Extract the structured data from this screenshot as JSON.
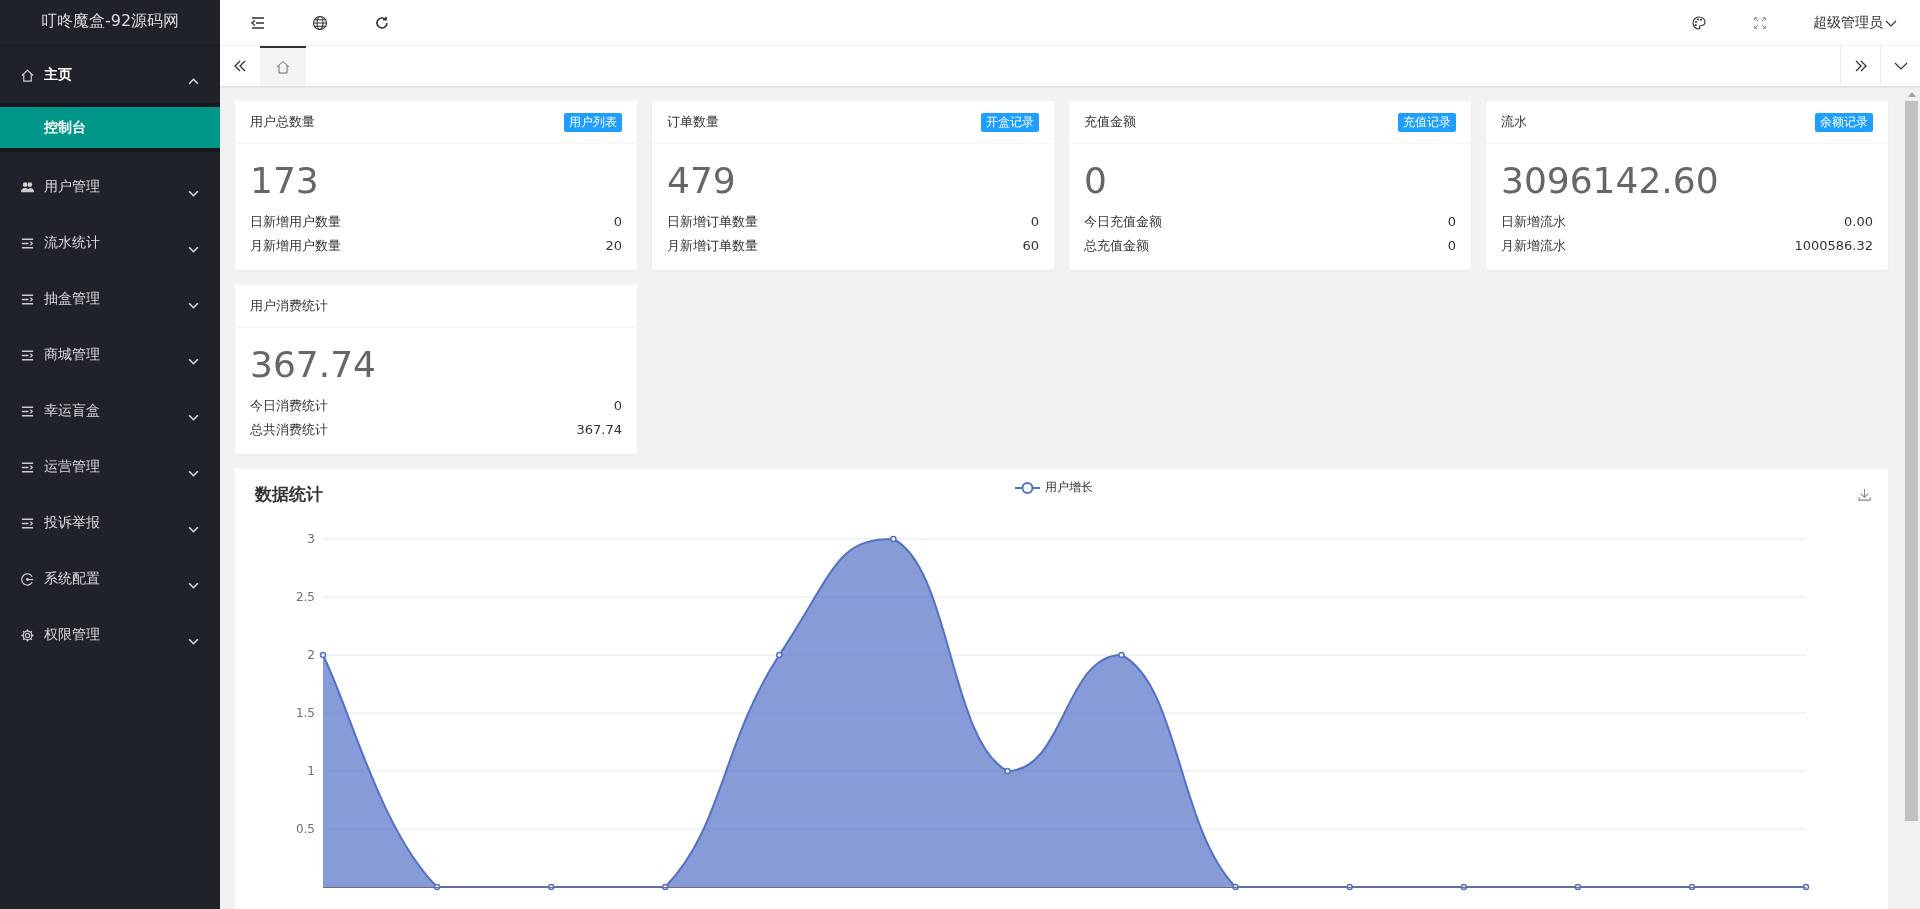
{
  "sidebar": {
    "logo": "叮咚魔盒-92源码网",
    "items": [
      {
        "label": "主页",
        "kind": "home",
        "expanded": true,
        "children": [
          {
            "label": "控制台",
            "selected": true
          }
        ]
      },
      {
        "label": "用户管理",
        "kind": "users",
        "expanded": false
      },
      {
        "label": "流水统计",
        "kind": "list",
        "expanded": false
      },
      {
        "label": "抽盒管理",
        "kind": "list",
        "expanded": false
      },
      {
        "label": "商城管理",
        "kind": "list",
        "expanded": false
      },
      {
        "label": "幸运盲盒",
        "kind": "list",
        "expanded": false
      },
      {
        "label": "运营管理",
        "kind": "list",
        "expanded": false
      },
      {
        "label": "投诉举报",
        "kind": "list",
        "expanded": false
      },
      {
        "label": "系统配置",
        "kind": "gauge",
        "expanded": false
      },
      {
        "label": "权限管理",
        "kind": "gear",
        "expanded": false
      }
    ]
  },
  "header": {
    "user": "超级管理员"
  },
  "tabs": [
    {
      "kind": "home",
      "selected": true
    }
  ],
  "cards": [
    {
      "title": "用户总数量",
      "badge": "用户列表",
      "value": "173",
      "rows": [
        {
          "label": "日新增用户数量",
          "value": "0"
        },
        {
          "label": "月新增用户数量",
          "value": "20"
        }
      ]
    },
    {
      "title": "订单数量",
      "badge": "开盒记录",
      "value": "479",
      "rows": [
        {
          "label": "日新增订单数量",
          "value": "0"
        },
        {
          "label": "月新增订单数量",
          "value": "60"
        }
      ]
    },
    {
      "title": "充值金额",
      "badge": "充值记录",
      "value": "0",
      "rows": [
        {
          "label": "今日充值金额",
          "value": "0"
        },
        {
          "label": "总充值金额",
          "value": "0"
        }
      ]
    },
    {
      "title": "流水",
      "badge": "余额记录",
      "value": "3096142.60",
      "rows": [
        {
          "label": "日新增流水",
          "value": "0.00"
        },
        {
          "label": "月新增流水",
          "value": "1000586.32"
        }
      ]
    },
    {
      "title": "用户消费统计",
      "value": "367.74",
      "rows": [
        {
          "label": "今日消费统计",
          "value": "0"
        },
        {
          "label": "总共消费统计",
          "value": "367.74"
        }
      ]
    }
  ],
  "chart_panel": {
    "title": "数据统计",
    "chart_data": {
      "type": "area",
      "grid": true,
      "ylim": [
        0,
        3
      ],
      "yticks": [
        0.5,
        1,
        1.5,
        2,
        2.5,
        3
      ],
      "series": [
        {
          "name": "用户增长",
          "color": "#5470c6",
          "values": [
            2,
            0,
            0,
            0,
            2,
            3,
            1,
            2,
            0,
            0,
            0,
            0,
            0,
            0
          ]
        }
      ]
    }
  }
}
